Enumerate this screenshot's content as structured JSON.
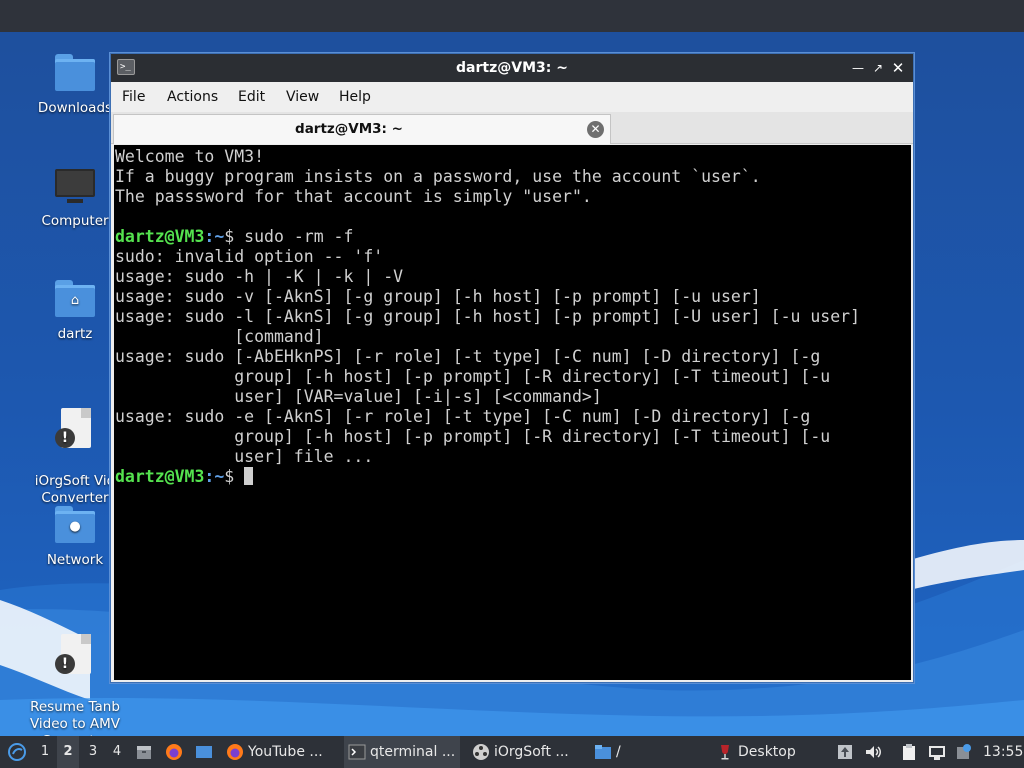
{
  "desktop": {
    "icons": [
      {
        "name": "desktop-icon-downloads",
        "label": "Downloads",
        "kind": "folder"
      },
      {
        "name": "desktop-icon-computer",
        "label": "Computer",
        "kind": "monitor"
      },
      {
        "name": "desktop-icon-dartz",
        "label": "dartz",
        "kind": "home-folder"
      },
      {
        "name": "desktop-icon-iorgsoft",
        "label": "iOrgSoft Vid\nConverter",
        "kind": "document-warning"
      },
      {
        "name": "desktop-icon-network",
        "label": "Network",
        "kind": "network-folder"
      },
      {
        "name": "desktop-icon-resume",
        "label": "Resume Tanb\nVideo to AMV\nConverter",
        "kind": "document-warning"
      }
    ]
  },
  "window": {
    "title": "dartz@VM3: ~",
    "menu": [
      "File",
      "Actions",
      "Edit",
      "View",
      "Help"
    ],
    "tab_title": "dartz@VM3: ~"
  },
  "terminal": {
    "prompt_user": "dartz@VM3",
    "prompt_path": ":~",
    "prompt_symbol": "$ ",
    "motd": [
      "Welcome to VM3!",
      "If a buggy program insists on a password, use the account `user`.",
      "The passsword for that account is simply \"user\"."
    ],
    "command": "sudo -rm -f",
    "output": [
      "sudo: invalid option -- 'f'",
      "usage: sudo -h | -K | -k | -V",
      "usage: sudo -v [-AknS] [-g group] [-h host] [-p prompt] [-u user]",
      "usage: sudo -l [-AknS] [-g group] [-h host] [-p prompt] [-U user] [-u user]",
      "            [command]",
      "usage: sudo [-AbEHknPS] [-r role] [-t type] [-C num] [-D directory] [-g",
      "            group] [-h host] [-p prompt] [-R directory] [-T timeout] [-u",
      "            user] [VAR=value] [-i|-s] [<command>]",
      "usage: sudo -e [-AknS] [-r role] [-t type] [-C num] [-D directory] [-g",
      "            group] [-h host] [-p prompt] [-R directory] [-T timeout] [-u",
      "            user] file ..."
    ]
  },
  "taskbar": {
    "workspaces": [
      "1",
      "2",
      "3",
      "4"
    ],
    "active_workspace": "2",
    "tasks": [
      {
        "label": "YouTube ...",
        "icon": "firefox-icon"
      },
      {
        "label": "qterminal ...",
        "icon": "terminal-icon"
      },
      {
        "label": "iOrgSoft ...",
        "icon": "film-reel-icon"
      },
      {
        "label": "/",
        "icon": "folder-icon"
      }
    ],
    "desktop_label": "Desktop",
    "clock": "13:55"
  },
  "colors": {
    "prompt_user": "#55e34f",
    "prompt_path": "#5f9fe6",
    "terminal_bg": "#000000",
    "terminal_fg": "#d0d0d0",
    "wallpaper": "#1d58b0"
  }
}
